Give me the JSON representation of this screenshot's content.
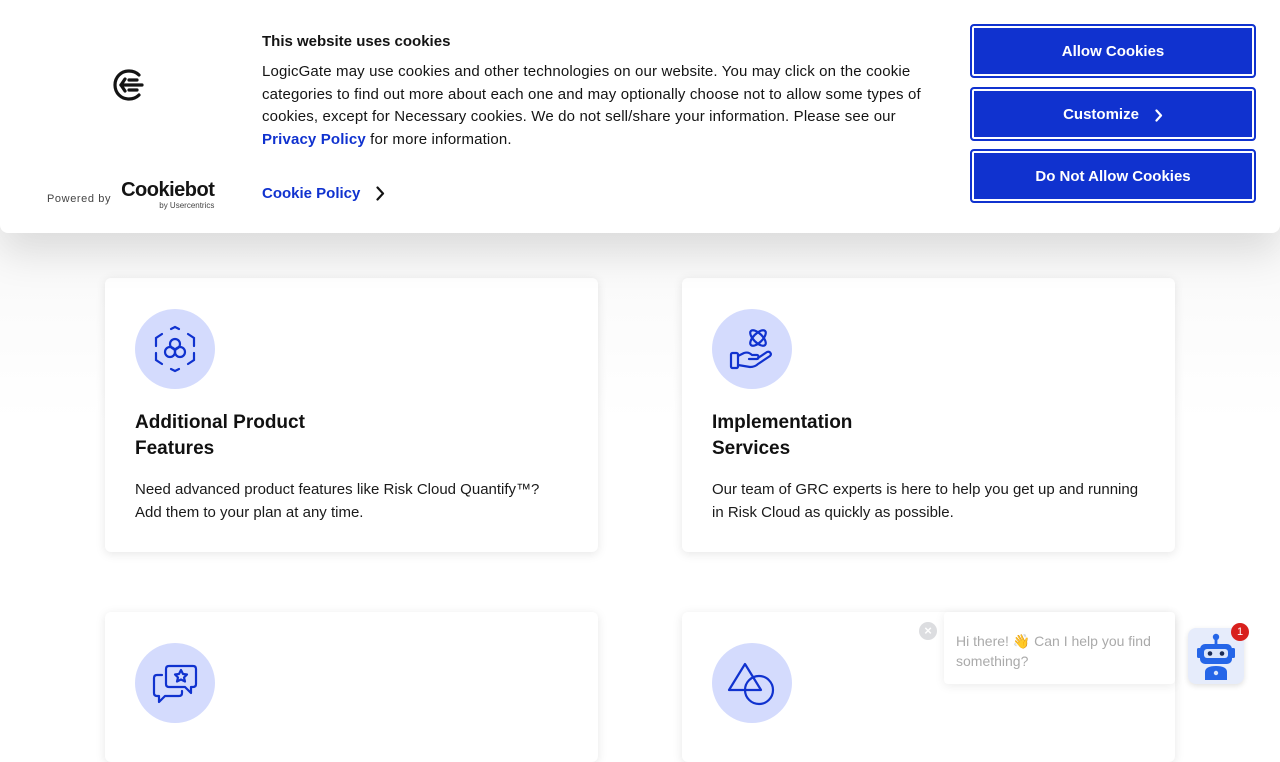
{
  "cookie_banner": {
    "title": "This website uses cookies",
    "body_prefix": "LogicGate may use cookies and other technologies on our website. You may click on the cookie categories to find out more about each one and may optionally choose not to allow some types of cookies, except for Necessary cookies.  We do not sell/share your information. Please see our ",
    "privacy_link": "Privacy Policy",
    "body_suffix": " for more information.",
    "cookie_policy_link": "Cookie Policy",
    "powered_by": "Powered by",
    "cookiebot_logo": "Cookiebot",
    "cookiebot_sub": "by Usercentrics",
    "buttons": {
      "allow": "Allow Cookies",
      "customize": "Customize",
      "deny": "Do Not Allow Cookies"
    },
    "accent_color": "#1032cf"
  },
  "cards": [
    {
      "icon": "hexagon-cluster-icon",
      "title": "Additional Product Features",
      "description": "Need advanced product features like Risk Cloud Quantify™? Add them to your plan at any time."
    },
    {
      "icon": "hand-atom-icon",
      "title": "Implementation Services",
      "description": "Our team of GRC experts is here to help you get up and running in Risk Cloud as quickly as possible."
    },
    {
      "icon": "chat-star-icon"
    },
    {
      "icon": "shapes-icon"
    }
  ],
  "chat_widget": {
    "message": "Hi there! 👋 Can I help you find something?",
    "badge_count": "1",
    "close_symbol": "×"
  }
}
